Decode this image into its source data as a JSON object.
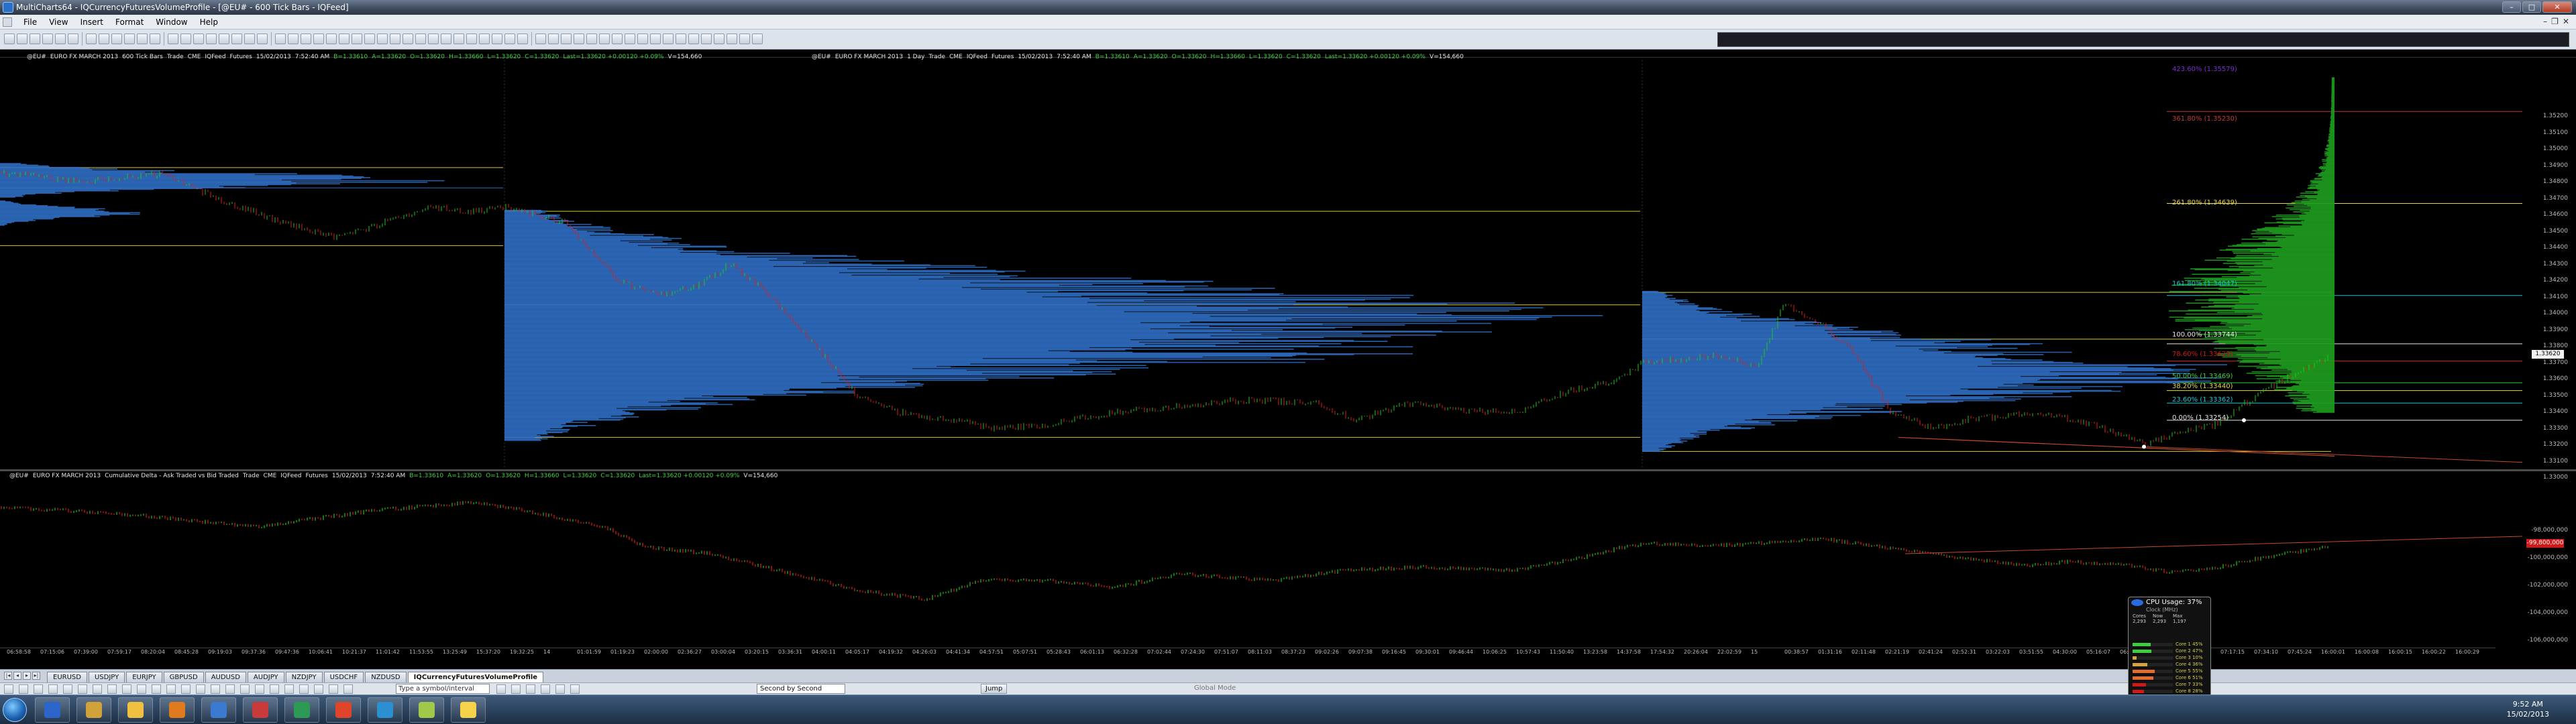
{
  "window": {
    "title": "MultiCharts64 - IQCurrencyFuturesVolumeProfile - [@EU# - 600 Tick Bars - IQFeed]"
  },
  "menu": [
    "File",
    "View",
    "Insert",
    "Format",
    "Window",
    "Help"
  ],
  "chart_left": {
    "header": [
      "@EU#",
      "EURO FX MARCH 2013",
      "600 Tick Bars",
      "Trade",
      "CME",
      "IQFeed",
      "Futures",
      "15/02/2013",
      "7:52:40 AM",
      "B=1.33610",
      "A=1.33620",
      "O=1.33620",
      "H=1.33660",
      "L=1.33620",
      "C=1.33620",
      "Last=1.33620 +0.00120 +0.09%",
      "V=154,660"
    ]
  },
  "chart_right": {
    "header": [
      "@EU#",
      "EURO FX MARCH 2013",
      "1 Day",
      "Trade",
      "CME",
      "IQFeed",
      "Futures",
      "15/02/2013",
      "7:52:40 AM",
      "B=1.33610",
      "A=1.33620",
      "O=1.33620",
      "H=1.33660",
      "L=1.33620",
      "C=1.33620",
      "Last=1.33620 +0.00120 +0.09%",
      "V=154,660"
    ]
  },
  "chart_sub": {
    "header": [
      "@EU#",
      "EURO FX MARCH 2013",
      "Cumulative Delta - Ask Traded vs Bid Traded",
      "Trade",
      "CME",
      "IQFeed",
      "Futures",
      "15/02/2013",
      "7:52:40 AM",
      "B=1.33610",
      "A=1.33620",
      "O=1.33620",
      "H=1.33660",
      "L=1.33620",
      "C=1.33620",
      "Last=1.33620 +0.00120 +0.09%",
      "V=154,660"
    ]
  },
  "price_axis": [
    "1.35200",
    "1.35100",
    "1.35000",
    "1.34900",
    "1.34800",
    "1.34700",
    "1.34600",
    "1.34500",
    "1.34400",
    "1.34300",
    "1.34200",
    "1.34100",
    "1.34000",
    "1.33900",
    "1.33800",
    "1.33700",
    "1.33600",
    "1.33500",
    "1.33400",
    "1.33300",
    "1.33200",
    "1.33100",
    "1.33000"
  ],
  "price_tags": {
    "last": "1.33620",
    "sub_last": "-99,800,000"
  },
  "sub_axis": [
    "-98,000,000",
    "-100,000,000",
    "-102,000,000",
    "-104,000,000",
    "-106,000,000"
  ],
  "fib_levels": [
    {
      "label": "423.60% (1.35579)",
      "color": "#7b2fd3"
    },
    {
      "label": "361.80% (1.35230)",
      "color": "#c23b3b"
    },
    {
      "label": "261.80% (1.34639)",
      "color": "#e4d64a"
    },
    {
      "label": "161.80% (1.34047)",
      "color": "#19c6d9"
    },
    {
      "label": "100.00% (1.33744)",
      "color": "#e6e6e6"
    },
    {
      "label": "78.60% (1.33629)",
      "color": "#d21919"
    },
    {
      "label": "50.00% (1.33469)",
      "color": "#3ecf3e"
    },
    {
      "label": "38.20% (1.33440)",
      "color": "#e4d64a"
    },
    {
      "label": "23.60% (1.33362)",
      "color": "#19c6d9"
    },
    {
      "label": "0.00% (1.33254)",
      "color": "#e6e6e6"
    }
  ],
  "time_axis": [
    "06:58:58",
    "07:15:06",
    "07:39:00",
    "07:59:17",
    "08:20:04",
    "08:45:28",
    "09:19:03",
    "09:37:36",
    "09:47:36",
    "10:06:41",
    "10:21:37",
    "11:01:42",
    "11:53:55",
    "13:25:49",
    "15:37:20",
    "19:32:25",
    "14",
    "01:01:59",
    "01:19:23",
    "02:00:00",
    "02:36:27",
    "03:00:04",
    "03:20:15",
    "03:36:31",
    "04:00:11",
    "04:05:17",
    "04:19:32",
    "04:26:03",
    "04:41:34",
    "04:57:51",
    "05:07:51",
    "05:28:43",
    "06:01:13",
    "06:32:28",
    "07:02:44",
    "07:24:30",
    "07:51:07",
    "08:11:03",
    "08:37:23",
    "09:02:26",
    "09:07:38",
    "09:16:45",
    "09:30:01",
    "09:46:44",
    "10:06:25",
    "10:57:43",
    "11:50:40",
    "13:23:58",
    "14:37:58",
    "17:54:32",
    "20:26:04",
    "22:02:59",
    "15",
    "00:38:57",
    "01:31:16",
    "02:11:48",
    "02:21:19",
    "02:41:24",
    "02:52:31",
    "03:22:03",
    "03:51:55",
    "04:30:00",
    "05:16:07",
    "06:00:02",
    "06:31:24",
    "07:09:21",
    "07:17:15",
    "07:34:10",
    "07:45:24",
    "16:00:01",
    "16:00:08",
    "16:00:15",
    "16:00:22",
    "16:00:29"
  ],
  "workspace_tabs": [
    "EURUSD",
    "USDJPY",
    "EURJPY",
    "GBPUSD",
    "AUDUSD",
    "AUDJPY",
    "NZDJPY",
    "USDCHF",
    "NZDUSD",
    "IQCurrencyFuturesVolumeProfile"
  ],
  "active_tab": "IQCurrencyFuturesVolumeProfile",
  "bottom": {
    "symbol_placeholder": "Type a symbol/interval",
    "mode": "Second by Second",
    "jump": "Jump",
    "global_mode": "Global Mode"
  },
  "cpu_gadget": {
    "title": "CPU Usage: 37%",
    "subtitle": "Clock (MHz)",
    "table": [
      [
        "Cores",
        "Now",
        "Max"
      ],
      [
        "2,293",
        "2,293",
        "1,197"
      ]
    ],
    "cores": [
      {
        "label": "Core 1",
        "pct": "45%",
        "value": 0.45,
        "color": "#3ecf3e"
      },
      {
        "label": "Core 2",
        "pct": "47%",
        "value": 0.47,
        "color": "#3ecf3e"
      },
      {
        "label": "Core 3",
        "pct": "10%",
        "value": 0.1,
        "color": "#d9a23c"
      },
      {
        "label": "Core 4",
        "pct": "36%",
        "value": 0.36,
        "color": "#d9a23c"
      },
      {
        "label": "Core 5",
        "pct": "55%",
        "value": 0.55,
        "color": "#e36b2b"
      },
      {
        "label": "Core 6",
        "pct": "51%",
        "value": 0.51,
        "color": "#e36b2b"
      },
      {
        "label": "Core 7",
        "pct": "33%",
        "value": 0.33,
        "color": "#d21919"
      },
      {
        "label": "Core 8",
        "pct": "28%",
        "value": 0.28,
        "color": "#d21919"
      }
    ]
  },
  "clock": {
    "time": "9:52 AM",
    "date": "15/02/2013"
  },
  "colors": {
    "up_bar": "#19c919",
    "down_bar": "#e01a1a",
    "volume_profile": "#2f6fc4",
    "profile_green": "#1e9a1e",
    "value_area_line": "#d8c83a",
    "trend_line": "#c24a2a"
  }
}
